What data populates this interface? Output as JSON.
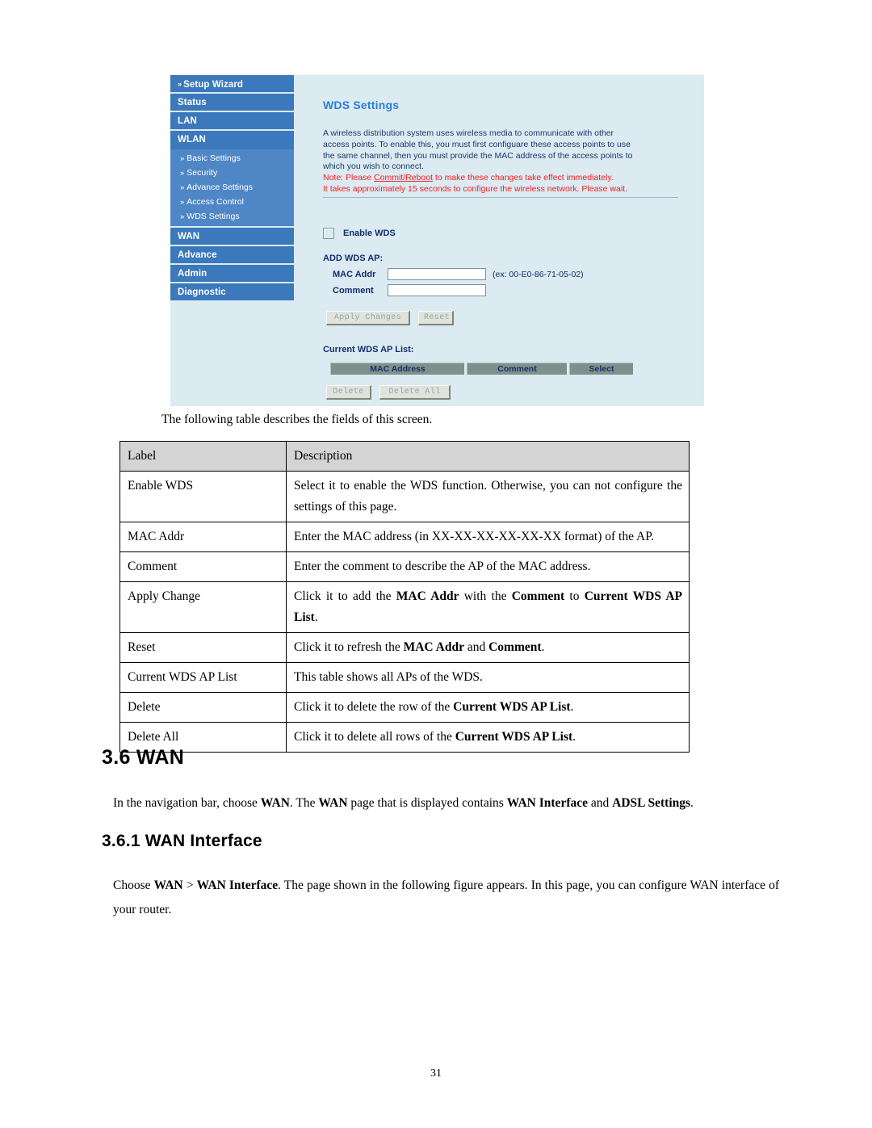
{
  "figure": {
    "sidebar": {
      "items": [
        {
          "label": "Setup Wizard",
          "chev": "»",
          "type": "main-chev"
        },
        {
          "label": "Status",
          "type": "main"
        },
        {
          "label": "LAN",
          "type": "main"
        },
        {
          "label": "WLAN",
          "type": "main"
        }
      ],
      "subitems": [
        {
          "chev": "»",
          "label": "Basic Settings"
        },
        {
          "chev": "»",
          "label": "Security"
        },
        {
          "chev": "»",
          "label": "Advance Settings"
        },
        {
          "chev": "»",
          "label": "Access Control"
        },
        {
          "chev": "»",
          "label": "WDS Settings"
        }
      ],
      "items_lower": [
        {
          "label": "WAN",
          "type": "main"
        },
        {
          "label": "Advance",
          "type": "main"
        },
        {
          "label": "Admin",
          "type": "main"
        },
        {
          "label": "Diagnostic",
          "type": "main"
        }
      ]
    },
    "content": {
      "title": "WDS Settings",
      "description_line1": "A wireless distribution system uses wireless media to communicate with other",
      "description_line2": "access points. To enable this, you must first configuare these access points to use",
      "description_line3": "the same channel, then you must provide the MAC address of the access points to",
      "description_line4": "which you wish to connect.",
      "note_prefix": "Note: Please ",
      "note_link": "Commit/Reboot",
      "note_suffix": " to make these changes take effect immediately.",
      "note_line2": "It takes approximately 15 seconds to configure the wireless network. Please wait.",
      "enable_wds_label": "Enable WDS",
      "enable_wds_checked": false,
      "add_wds_ap_label": "ADD WDS AP:",
      "mac_addr_label": "MAC Addr",
      "mac_addr_value": "",
      "mac_addr_example": "(ex: 00-E0-86-71-05-02)",
      "comment_label": "Comment",
      "comment_value": "",
      "apply_changes_button": "Apply Changes",
      "reset_button": "Reset",
      "current_list_label": "Current WDS AP List:",
      "table_headers": [
        "MAC Address",
        "Comment",
        "Select"
      ],
      "delete_button": "Delete",
      "delete_all_button": "Delete All"
    },
    "colors": {
      "panel_bg": "#dceaf2",
      "nav_main_bg": "#3b79bc",
      "nav_sub_bg": "#4f87c6",
      "title_blue": "#2b7fd4",
      "body_blue": "#1b3a6b",
      "note_red": "#ee2222",
      "table_header_bg": "#7f918c"
    }
  },
  "document": {
    "intro_line": "The following table describes the fields of this screen.",
    "table": {
      "headers": [
        "Label",
        "Description"
      ],
      "rows": [
        {
          "label": "Enable WDS",
          "desc_html": "Select it to enable the WDS function. Otherwise, you can not configure the settings of this page."
        },
        {
          "label": "MAC Addr",
          "desc_html": "Enter the MAC address (in XX-XX-XX-XX-XX-XX format) of the AP."
        },
        {
          "label": "Comment",
          "desc_html": "Enter the comment to describe the AP of the MAC address."
        },
        {
          "label": "Apply Change",
          "desc_html": "Click it to add the <b>MAC Addr</b> with the <b>Comment</b> to <b>Current WDS AP List</b>."
        },
        {
          "label": "Reset",
          "desc_html": "Click it to refresh the <b>MAC Addr</b> and <b>Comment</b>."
        },
        {
          "label": "Current WDS AP List",
          "desc_html": "This table shows all APs of the WDS."
        },
        {
          "label": "Delete",
          "desc_html": "Click it to delete the row of the <b>Current WDS AP List</b>."
        },
        {
          "label": "Delete All",
          "desc_html": "Click it to delete all rows of the <b>Current WDS AP List</b>."
        }
      ]
    },
    "section_36_number": "3.6",
    "section_36_title": "WAN",
    "section_36_heading": "3.6  WAN",
    "paragraph_wan_html": "In the navigation bar, choose <b>WAN</b>. The <b>WAN</b> page that is displayed contains <b>WAN Interface</b> and <b>ADSL Settings</b>.",
    "section_361_heading": "3.6.1  WAN Interface",
    "paragraph_wan_interface_html": "Choose <b>WAN</b> &gt; <b>WAN Interface</b>. The page shown in the following figure appears. In this page, you can configure WAN interface of your router.",
    "page_number": "31"
  }
}
